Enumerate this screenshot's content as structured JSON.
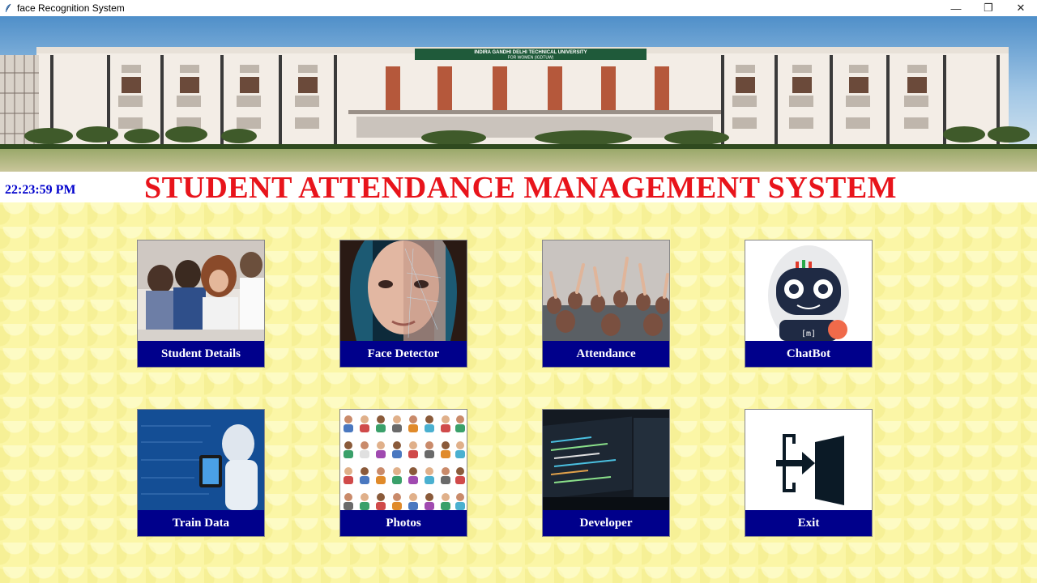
{
  "window": {
    "title": "face Recognition System",
    "controls": {
      "minimize": "—",
      "restore": "❐",
      "close": "✕"
    }
  },
  "banner": {
    "sign_line1": "INDIRA GANDHI DELHI TECHNICAL UNIVERSITY",
    "sign_line2": "FOR WOMEN (IGDTUW)"
  },
  "header": {
    "clock": "22:23:59 PM",
    "title": "STUDENT ATTENDANCE MANAGEMENT SYSTEM"
  },
  "tiles": [
    {
      "label": "Student Details",
      "icon": "students-photo"
    },
    {
      "label": "Face Detector",
      "icon": "face-scan-photo"
    },
    {
      "label": "Attendance",
      "icon": "classroom-photo"
    },
    {
      "label": "ChatBot",
      "icon": "robot-icon"
    },
    {
      "label": "Train Data",
      "icon": "ai-robot-photo"
    },
    {
      "label": "Photos",
      "icon": "people-grid-photo"
    },
    {
      "label": "Developer",
      "icon": "code-screen-photo"
    },
    {
      "label": "Exit",
      "icon": "exit-door-icon"
    }
  ],
  "colors": {
    "title": "#e8141b",
    "clock": "#0000cc",
    "tile_label_bg": "#00008b",
    "background": "#fbf6a6"
  }
}
